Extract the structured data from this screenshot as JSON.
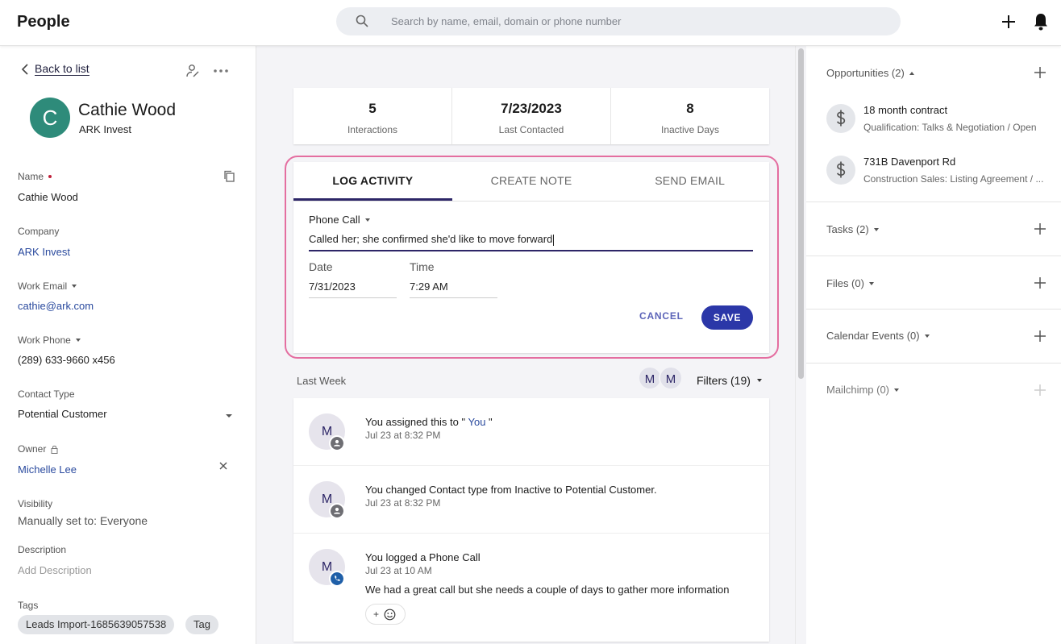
{
  "header": {
    "title": "People",
    "search_placeholder": "Search by name, email, domain or phone number"
  },
  "contact": {
    "back_label": "Back to list",
    "avatar_initial": "C",
    "name": "Cathie Wood",
    "company": "ARK Invest",
    "fields": {
      "name_label": "Name",
      "name_value": "Cathie Wood",
      "company_label": "Company",
      "company_value": "ARK Invest",
      "email_label": "Work Email",
      "email_value": "cathie@ark.com",
      "phone_label": "Work Phone",
      "phone_value": "(289) 633-9660 x456",
      "contact_type_label": "Contact Type",
      "contact_type_value": "Potential Customer",
      "owner_label": "Owner",
      "owner_value": "Michelle Lee",
      "visibility_label": "Visibility",
      "visibility_value": "Manually set to: Everyone",
      "description_label": "Description",
      "description_placeholder": "Add Description",
      "tags_label": "Tags"
    },
    "tags": [
      "Leads Import-1685639057538",
      "Tag"
    ]
  },
  "stats": [
    {
      "value": "5",
      "label": "Interactions"
    },
    {
      "value": "7/23/2023",
      "label": "Last Contacted"
    },
    {
      "value": "8",
      "label": "Inactive Days"
    }
  ],
  "activity": {
    "tabs": [
      "LOG ACTIVITY",
      "CREATE NOTE",
      "SEND EMAIL"
    ],
    "active_tab": "LOG ACTIVITY",
    "type": "Phone Call",
    "text": "Called her; she confirmed she'd like to move forward",
    "date_label": "Date",
    "date_value": "7/31/2023",
    "time_label": "Time",
    "time_value": "7:29 AM",
    "cancel_label": "CANCEL",
    "save_label": "SAVE"
  },
  "feed": {
    "section_label": "Last Week",
    "avatars": [
      "M",
      "M"
    ],
    "filters_label": "Filters (19)",
    "items": [
      {
        "initial": "M",
        "title_prefix": "You assigned this to \" ",
        "title_link": "You",
        "title_suffix": " \"",
        "time": "Jul 23 at 8:32 PM",
        "badge": "person-icon"
      },
      {
        "initial": "M",
        "title": "You changed Contact type from Inactive to Potential Customer.",
        "time": "Jul 23 at 8:32 PM",
        "badge": "person-icon"
      },
      {
        "initial": "M",
        "title": "You logged a Phone Call",
        "time": "Jul 23 at 10 AM",
        "body": "We had a great call but she needs a couple of days to gather more information",
        "badge": "phone-icon",
        "react_plus": "+"
      }
    ]
  },
  "right": {
    "opportunities": {
      "label": "Opportunities (2)",
      "items": [
        {
          "name": "18 month contract",
          "sub": "Qualification: Talks & Negotiation / Open"
        },
        {
          "name": "731B Davenport Rd",
          "sub": "Construction Sales: Listing Agreement / ..."
        }
      ]
    },
    "tasks_label": "Tasks (2)",
    "files_label": "Files (0)",
    "calendar_label": "Calendar Events (0)",
    "mailchimp_label": "Mailchimp (0)"
  },
  "colors": {
    "accent": "#2d2667",
    "save_button": "#2b37a8",
    "highlight": "#e46ea0",
    "avatar": "#2e8b7a",
    "link": "#2a4a9e"
  }
}
